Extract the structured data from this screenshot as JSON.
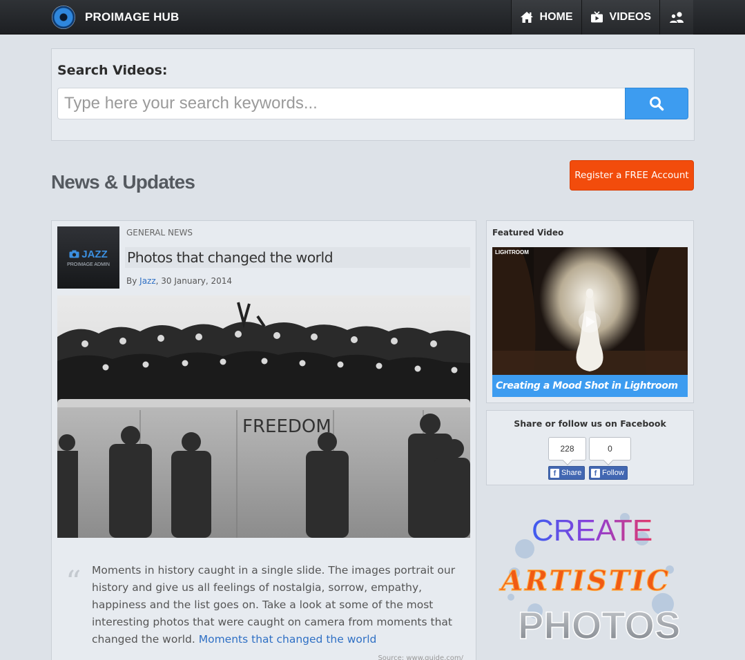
{
  "header": {
    "brand": "PROIMAGE HUB",
    "nav": [
      {
        "label": "HOME",
        "icon": "home-icon"
      },
      {
        "label": "VIDEOS",
        "icon": "tv-icon"
      },
      {
        "label": "",
        "icon": "users-icon"
      }
    ]
  },
  "search": {
    "title": "Search Videos:",
    "placeholder": "Type here your search keywords...",
    "value": "",
    "button_icon": "search-icon"
  },
  "page": {
    "heading": "News & Updates",
    "register_label": "Register a FREE Account"
  },
  "article": {
    "avatar_title": "JAZZ",
    "avatar_subtitle": "PROIMAGE ADMIN",
    "category": "GENERAL NEWS",
    "title": "Photos that changed the world",
    "by": "By ",
    "author": "Jazz",
    "date": ", 30 January, 2014",
    "image_text": "FREEDOM",
    "quote": "Moments in history caught in a single slide. The images portrait our history and give us all feelings of nostalgia, sorrow, empathy, happiness and the list goes on. Take a look at some of the most interesting photos that were caught on camera from moments that changed the world. ",
    "quote_link": "Moments that changed the world",
    "source": "Source: www.guide.com/"
  },
  "sidebar": {
    "featured_heading": "Featured Video",
    "featured_tag": "LIGHTROOM",
    "featured_caption": "Creating a Mood Shot in Lightroom",
    "facebook_heading": "Share or follow us on Facebook",
    "share_count": "228",
    "follow_count": "0",
    "share_label": "Share",
    "follow_label": "Follow",
    "promo": {
      "line1": "CREATE",
      "line2": "ARTISTIC",
      "line3": "PHOTOS"
    }
  }
}
